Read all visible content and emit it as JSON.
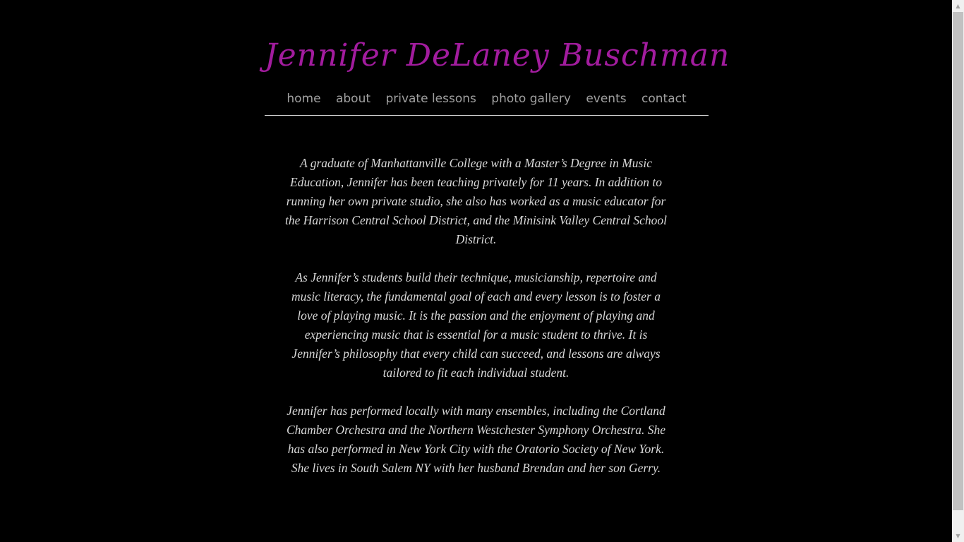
{
  "header": {
    "site_title": "Jennifer  DeLaney Buschman"
  },
  "nav": {
    "items": [
      {
        "label": "home"
      },
      {
        "label": "about"
      },
      {
        "label": "private lessons"
      },
      {
        "label": "photo gallery"
      },
      {
        "label": "events"
      },
      {
        "label": "contact"
      }
    ]
  },
  "main": {
    "paragraphs": [
      "A graduate of Manhattanville College with a Master’s Degree in Music Education, Jennifer has been teaching privately for 11 years. In addition to running her own private studio, she also has worked as a music educator for the Harrison Central School District, and the Minisink Valley Central School District.",
      "As Jennifer’s students build their technique, musicianship, repertoire and music literacy, the fundamental goal of each and every lesson is to foster a love of playing music. It is the passion and the enjoyment of playing and experiencing music that is essential for a music student to thrive. It is Jennifer’s philosophy that every child can succeed, and lessons are always tailored to fit each individual student.",
      "Jennifer has performed locally with many ensembles, including the Cortland Chamber Orchestra and the Northern Westchester Symphony Orchestra. She has also performed in New York City with the Oratorio Society of New York. She lives in South Salem NY with her husband Brendan and her son Gerry."
    ]
  },
  "scrollbar": {
    "up_icon": "triangle-up",
    "down_icon": "triangle-down"
  },
  "colors": {
    "background": "#000000",
    "title": "#a21c9e",
    "nav_link": "#a0a0a0",
    "body_text": "#d8d8d8",
    "rule": "#d6d6d6"
  }
}
